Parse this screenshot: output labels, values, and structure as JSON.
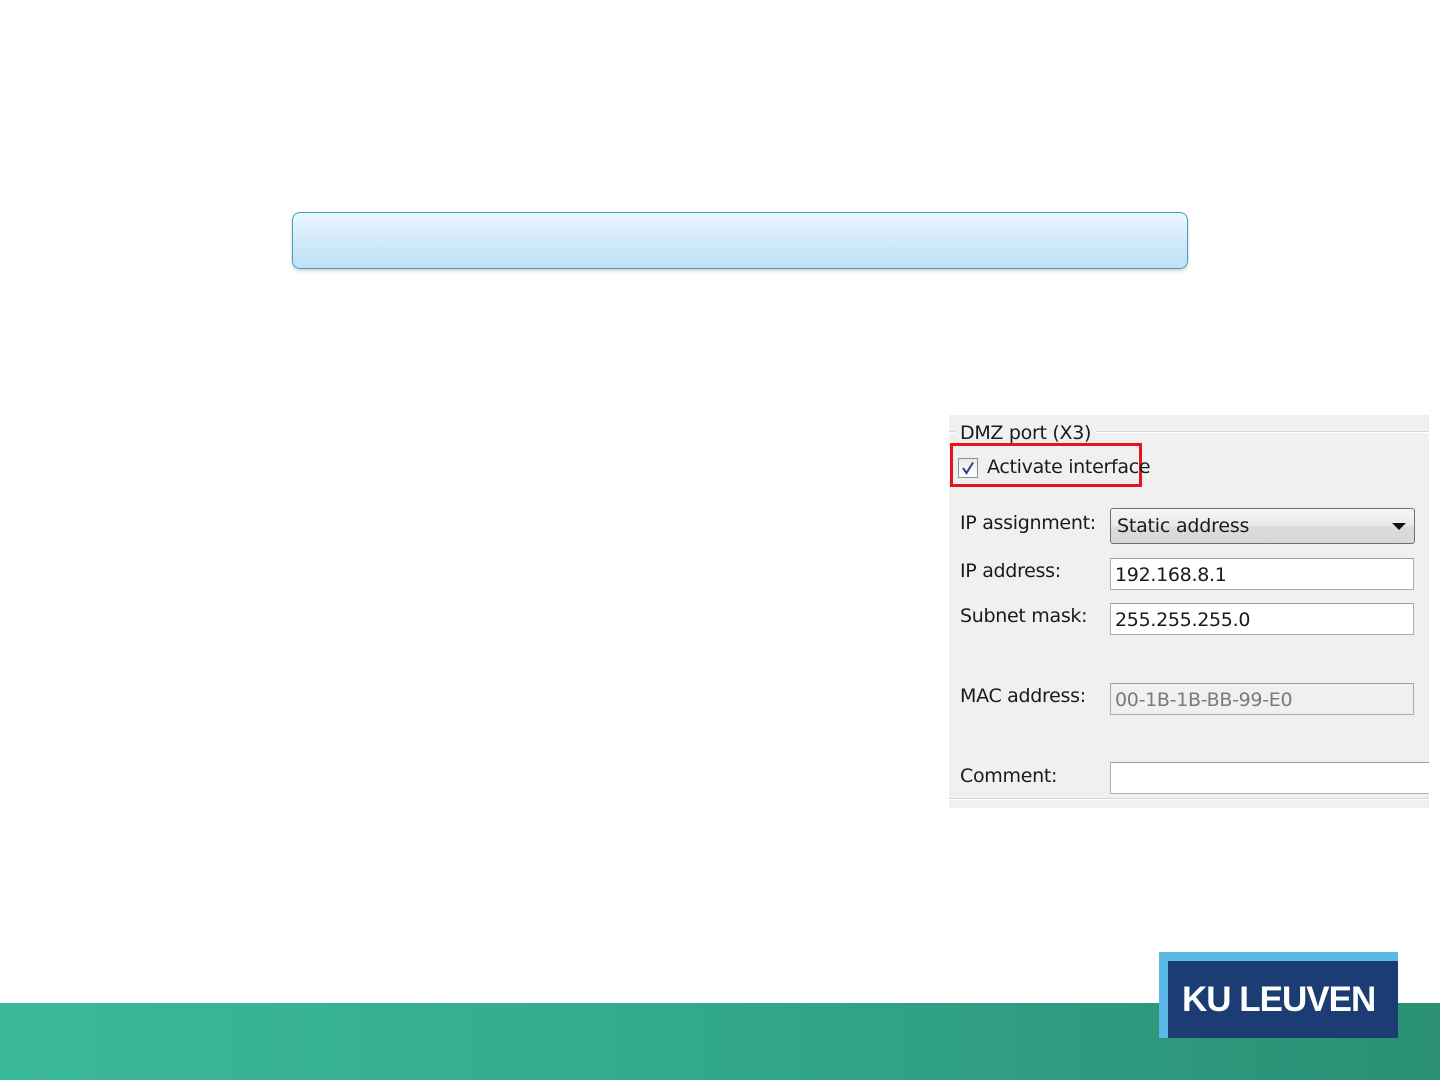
{
  "settings": {
    "group_title": "DMZ port (X3)",
    "activate": {
      "label": "Activate interface",
      "checked": true
    },
    "ip_assignment": {
      "label": "IP assignment:",
      "value": "Static address"
    },
    "ip_address": {
      "label": "IP address:",
      "value": "192.168.8.1"
    },
    "subnet_mask": {
      "label": "Subnet mask:",
      "value": "255.255.255.0"
    },
    "mac_address": {
      "label": "MAC address:",
      "value": "00-1B-1B-BB-99-E0"
    },
    "comment": {
      "label": "Comment:",
      "value": ""
    }
  },
  "logo": {
    "text": "KU LEUVEN"
  },
  "colors": {
    "highlight": "#e4161b",
    "band": "#33aa8d",
    "logo_background": "#1c3d73",
    "logo_accent": "#5bb7e6",
    "title_bar": "#cfe9fb"
  },
  "icons": {
    "checkbox": "check-icon",
    "dropdown": "chevron-down-icon"
  }
}
